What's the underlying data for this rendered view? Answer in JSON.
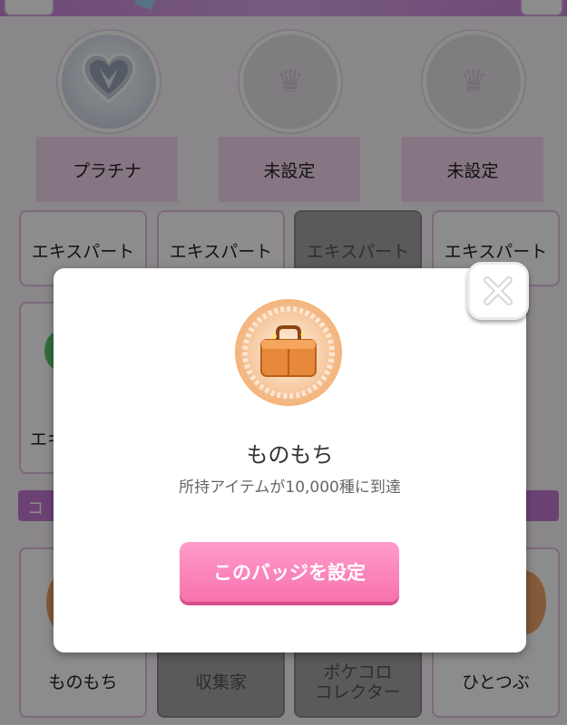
{
  "background": {
    "badge_slots": [
      {
        "label": "プラチナ",
        "icon": "platinum-heart-badge-icon"
      },
      {
        "label": "未設定",
        "icon": "crown-icon"
      },
      {
        "label": "未設定",
        "icon": "crown-icon"
      }
    ],
    "row1_cards": [
      {
        "label": "エキスパート"
      },
      {
        "label": "エキスパート"
      },
      {
        "label": "エキスパート"
      },
      {
        "label": "エキスパート"
      }
    ],
    "row2_partial_label": "エキ",
    "section_title": "コ",
    "row3_cards": [
      {
        "label": "ものもち"
      },
      {
        "label": "収集家"
      },
      {
        "label": "ポケコロ\nコレクター"
      },
      {
        "label": "ひとつぶ"
      }
    ]
  },
  "modal": {
    "badge_icon": "suitcase-badge-icon",
    "title": "ものもち",
    "description": "所持アイテムが10,000種に到達",
    "set_button_label": "このバッジを設定",
    "close_icon": "close-icon"
  },
  "colors": {
    "accent_pink": "#f772ad",
    "section_purple": "#c579d6",
    "badge_orange": "#e98c3e"
  }
}
